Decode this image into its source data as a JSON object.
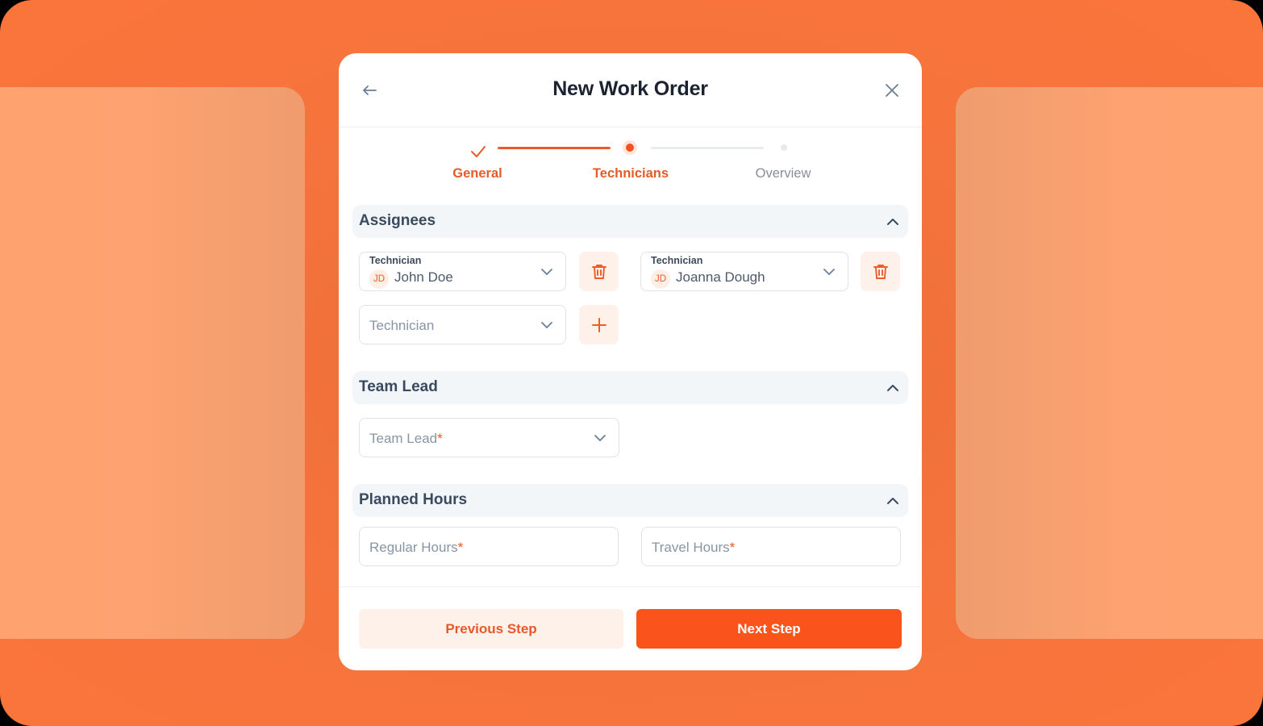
{
  "modal": {
    "title": "New Work Order",
    "back_icon": "arrow-left-icon",
    "close_icon": "close-icon"
  },
  "stepper": {
    "steps": [
      {
        "label": "General",
        "status": "completed"
      },
      {
        "label": "Technicians",
        "status": "active"
      },
      {
        "label": "Overview",
        "status": "pending"
      }
    ]
  },
  "sections": {
    "assignees": {
      "title": "Assignees",
      "expanded": true,
      "technicians": [
        {
          "label": "Technician",
          "initials": "JD",
          "name": "John Doe"
        },
        {
          "label": "Technician",
          "initials": "JD",
          "name": "Joanna Dough"
        }
      ],
      "new_technician_placeholder": "Technician"
    },
    "team_lead": {
      "title": "Team Lead",
      "expanded": true,
      "placeholder": "Team Lead",
      "required_mark": "*"
    },
    "planned_hours": {
      "title": "Planned Hours",
      "expanded": true,
      "regular_placeholder": "Regular Hours",
      "travel_placeholder": "Travel Hours",
      "required_mark": "*"
    }
  },
  "footer": {
    "previous_label": "Previous Step",
    "next_label": "Next Step"
  },
  "colors": {
    "accent": "#fa541c",
    "accent_soft": "#fdf1ea",
    "background": "#f4733c"
  }
}
